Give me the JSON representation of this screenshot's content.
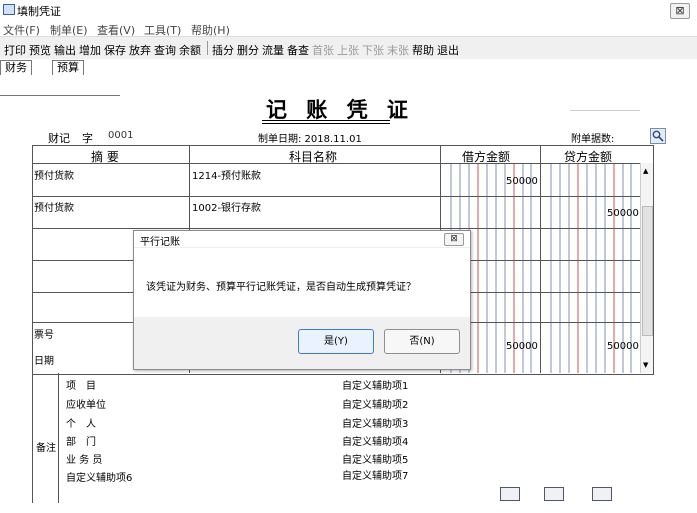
{
  "window": {
    "title": "填制凭证",
    "close_glyph": "⊠"
  },
  "menu": [
    {
      "label": "文件(F)"
    },
    {
      "label": "制单(E)"
    },
    {
      "label": "查看(V)"
    },
    {
      "label": "工具(T)"
    },
    {
      "label": "帮助(H)"
    }
  ],
  "toolbar": {
    "group1": [
      "打印",
      "预览",
      "输出",
      "增加",
      "保存",
      "放弃",
      "查询",
      "余额"
    ],
    "group2": [
      "插分",
      "删分",
      "流量",
      "备查"
    ],
    "group2_disabled": [
      "首张",
      "上张",
      "下张",
      "末张"
    ],
    "group3": [
      "帮助",
      "退出"
    ]
  },
  "tabs": [
    {
      "label": "财务"
    },
    {
      "label": "预算"
    }
  ],
  "voucher": {
    "title": "记 账 凭 证",
    "type_label": "财记",
    "zi": "字",
    "number": "0001",
    "date_label": "制单日期: 2018.11.01",
    "attachments_label": "附单据数:",
    "columns": {
      "summary": "摘 要",
      "account": "科目名称",
      "debit": "借方金额",
      "credit": "贷方金额"
    },
    "rows": [
      {
        "summary": "预付货款",
        "account": "1214-预付账款",
        "debit": "50000",
        "credit": ""
      },
      {
        "summary": "预付货款",
        "account": "1002-银行存款",
        "debit": "",
        "credit": "50000"
      }
    ],
    "ticket_label": "票号",
    "date_row_label": "日期",
    "total_debit": "50000",
    "total_credit": "50000"
  },
  "remarks": {
    "label": "备注",
    "left": [
      "项　目",
      "应收单位",
      "个　人",
      "部　门",
      "业 务 员",
      "自定义辅助项6"
    ],
    "right": [
      "自定义辅助项1",
      "自定义辅助项2",
      "自定义辅助项3",
      "自定义辅助项4",
      "自定义辅助项5",
      "自定义辅助项7"
    ]
  },
  "dialog": {
    "title": "平行记账",
    "close_glyph": "⊠",
    "message": "该凭证为财务、预算平行记账凭证，是否自动生成预算凭证？",
    "yes_label": "是(Y)",
    "no_label": "否(N)"
  },
  "colors": {
    "grid_red": "#c2262b",
    "grid_blue": "#2a4a8c",
    "accent": "#3a7bd5"
  }
}
